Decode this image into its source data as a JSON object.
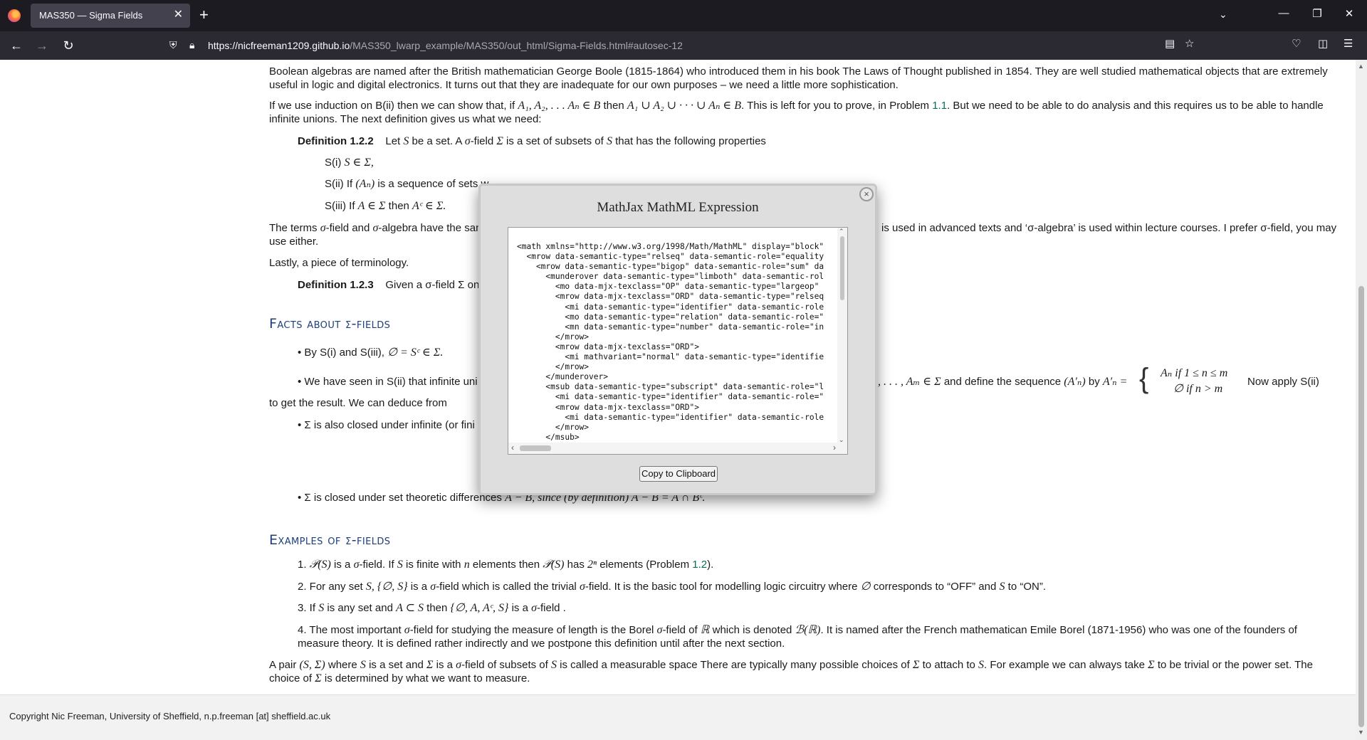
{
  "browser": {
    "tab_title": "MAS350 — Sigma Fields",
    "tab_close": "✕",
    "new_tab": "+",
    "url_host": "https://nicfreeman1209.github.io",
    "url_path": "/MAS350_lwarp_example/MAS350/out_html/Sigma-Fields.html#autosec-12"
  },
  "page": {
    "p1": "Boolean algebras are named after the British mathematician George Boole (1815-1864) who introduced them in his book The Laws of Thought published in 1854. They are well studied mathematical objects that are extremely useful in logic and digital electronics. It turns out that they are inadequate for our own purposes – we need a little more sophistication.",
    "p2_a": "If we use induction on B(ii) then we can show that, if ",
    "p2_m1": "A₁, A₂, . . . Aₙ ∈ B",
    "p2_b": " then ",
    "p2_m2": "A₁ ∪ A₂ ∪ · · · ∪ Aₙ ∈ B",
    "p2_c": ". This is left for you to prove, in Problem ",
    "p2_link": "1.1",
    "p2_d": ". But we need to be able to do analysis and this requires us to be able to handle infinite unions. The next definition gives us what we need:",
    "def1_label": "Definition 1.2.2",
    "def1_a": "Let ",
    "def1_m1": "S",
    "def1_b": " be a set. A ",
    "def1_sigma": "σ",
    "def1_c": "-field ",
    "def1_m2": "Σ",
    "def1_d": " is a set of subsets of ",
    "def1_m3": "S",
    "def1_e": " that has the following properties",
    "s1_label": "S(i) ",
    "s1_m": "S ∈ Σ,",
    "s2_label": "S(ii) If ",
    "s2_m": "(Aₙ)",
    "s2_b": " is a sequence of sets w",
    "s3_label": "S(iii) If ",
    "s3_m1": "A ∈ Σ",
    "s3_b": " then ",
    "s3_m2": "Aᶜ ∈ Σ.",
    "terms_a": "The terms ",
    "terms_b": "-field and ",
    "terms_c": "-algebra have the san",
    "terms_right": " is used in advanced texts and ‘σ-algebra’ is used within lecture courses. I prefer σ-field, you may",
    "terms_line2": "use either.",
    "lastly": "Lastly, a piece of terminology.",
    "def2_label": "Definition 1.2.3",
    "def2_text": "Given a σ-field Σ on",
    "h_facts": "Facts about σ-fields",
    "f1_a": "• By S(i) and S(iii), ",
    "f1_m": "∅ = Sᶜ ∈ Σ.",
    "f2_a": "• We have seen in S(ii) that infinite uni",
    "f2_right_m": ", . . . , Aₘ ∈ Σ",
    "f2_right_b": " and define the sequence ",
    "f2_right_m2": "(A′ₙ)",
    "f2_right_c": " by ",
    "f2_right_m3": "A′ₙ =",
    "f2_case1": "Aₙ if 1 ≤ n ≤ m",
    "f2_case2": "∅ if n > m",
    "f2_tail": "Now apply S(ii)",
    "f2_line2": "to get the result. We can deduce from",
    "f3": "• Σ is also closed under infinite (or fini",
    "f4_a": "• Σ is closed under set theoretic differences ",
    "f4_m": "A − B, since (by definition) A − B = A ∩ Bᶜ.",
    "h_examples": "Examples of σ-fields",
    "e1_a": "1. ",
    "e1_m1": "𝒫(S)",
    "e1_b": " is a ",
    "e1_c": "-field. If ",
    "e1_m2": "S",
    "e1_d": " is finite with ",
    "e1_m3": "n",
    "e1_e": " elements then ",
    "e1_m4": "𝒫(S)",
    "e1_f": " has ",
    "e1_m5": "2ⁿ",
    "e1_g": " elements (Problem ",
    "e1_link": "1.2",
    "e1_h": ").",
    "e2_a": "2. For any set ",
    "e2_m1": "S, {∅, S}",
    "e2_b": " is a ",
    "e2_c": "-field which is called the trivial ",
    "e2_d": "-field. It is the basic tool for modelling logic circuitry where ",
    "e2_m2": "∅",
    "e2_e": " corresponds to “OFF” and ",
    "e2_m3": "S",
    "e2_f": " to “ON”.",
    "e3_a": "3. If ",
    "e3_m1": "S",
    "e3_b": " is any set and ",
    "e3_m2": "A ⊂ S",
    "e3_c": " then ",
    "e3_m3": "{∅, A, Aᶜ, S}",
    "e3_d": " is a ",
    "e3_e": "-field .",
    "e4_a": "4. The most important ",
    "e4_b": "-field for studying the measure of length is the Borel ",
    "e4_c": "-field of ",
    "e4_m1": "ℝ",
    "e4_d": " which is denoted ",
    "e4_m2": "ℬ(ℝ)",
    "e4_e": ". It is named after the French mathematican Emile Borel (1871-1956) who was one of the founders of measure theory. It is defined rather indirectly and we postpone this definition until after the next section.",
    "pair_a": "A pair ",
    "pair_m1": "(S, Σ)",
    "pair_b": " where ",
    "pair_m2": "S",
    "pair_c": " is a set and ",
    "pair_m3": "Σ",
    "pair_d": " is a ",
    "pair_e": "-field of subsets of ",
    "pair_m4": "S",
    "pair_f": " is called a measurable space There are typically many possible choices of ",
    "pair_m5": "Σ",
    "pair_g": " to attach to ",
    "pair_m6": "S",
    "pair_h": ". For example we can always take ",
    "pair_m7": "Σ",
    "pair_i": " to be trivial or the power set. The choice of ",
    "pair_m8": "Σ",
    "pair_j": " is determined by what we want to measure.",
    "sigma": "σ",
    "footer": "Copyright Nic Freeman, University of Sheffield, n.p.freeman [at] sheffield.ac.uk"
  },
  "modal": {
    "title": "MathJax MathML Expression",
    "close": "×",
    "code": "<math xmlns=\"http://www.w3.org/1998/Math/MathML\" display=\"block\"\n  <mrow data-semantic-type=\"relseq\" data-semantic-role=\"equality\n    <mrow data-semantic-type=\"bigop\" data-semantic-role=\"sum\" da\n      <munderover data-semantic-type=\"limboth\" data-semantic-rol\n        <mo data-mjx-texclass=\"OP\" data-semantic-type=\"largeop\"\n        <mrow data-mjx-texclass=\"ORD\" data-semantic-type=\"relseq\n          <mi data-semantic-type=\"identifier\" data-semantic-role\n          <mo data-semantic-type=\"relation\" data-semantic-role=\"\n          <mn data-semantic-type=\"number\" data-semantic-role=\"in\n        </mrow>\n        <mrow data-mjx-texclass=\"ORD\">\n          <mi mathvariant=\"normal\" data-semantic-type=\"identifie\n        </mrow>\n      </munderover>\n      <msub data-semantic-type=\"subscript\" data-semantic-role=\"l\n        <mi data-semantic-type=\"identifier\" data-semantic-role=\"\n        <mrow data-mjx-texclass=\"ORD\">\n          <mi data-semantic-type=\"identifier\" data-semantic-role\n        </mrow>\n      </msub>",
    "copy_button": "Copy to Clipboard"
  }
}
